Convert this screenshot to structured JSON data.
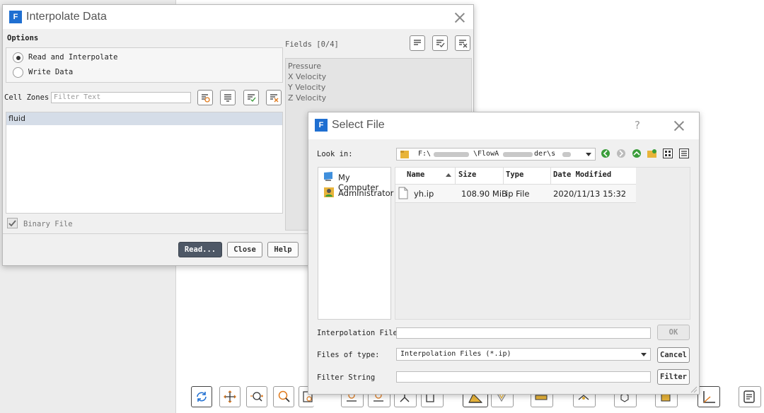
{
  "interpolate": {
    "logo": "F",
    "title": "Interpolate Data",
    "options_label": "Options",
    "option_read": "Read and Interpolate",
    "option_write": "Write Data",
    "cell_zones_label": "Cell Zones",
    "filter_placeholder": "Filter Text",
    "zones": [
      "fluid"
    ],
    "binary_label": "Binary File",
    "fields_label": "Fields [0/4]",
    "fields": [
      "Pressure",
      "X Velocity",
      "Y Velocity",
      "Z Velocity"
    ],
    "read_btn": "Read...",
    "close_btn": "Close",
    "help_btn": "Help"
  },
  "select_file": {
    "logo": "F",
    "title": "Select File",
    "help_mark": "?",
    "look_in_label": "Look in:",
    "path_a": "F:\\",
    "path_b": "\\FlowA",
    "path_c": "der\\s",
    "places": [
      "My Computer",
      "Administrator"
    ],
    "columns": [
      "Name",
      "Size",
      "Type",
      "Date Modified"
    ],
    "file": {
      "name": "yh.ip",
      "size": "108.90 MiB",
      "type": "ip File",
      "date": "2020/11/13 15:32"
    },
    "interp_file_label": "Interpolation File",
    "ok_btn": "OK",
    "files_of_type_label": "Files of type:",
    "files_of_type_value": "Interpolation Files (*.ip)",
    "cancel_btn": "Cancel",
    "filter_string_label": "Filter String",
    "filter_btn": "Filter"
  },
  "colors": {
    "accent": "#1f6fd1",
    "primary_button": "#4e5866",
    "selection": "#d5dde8",
    "folder": "#e8b43a"
  }
}
